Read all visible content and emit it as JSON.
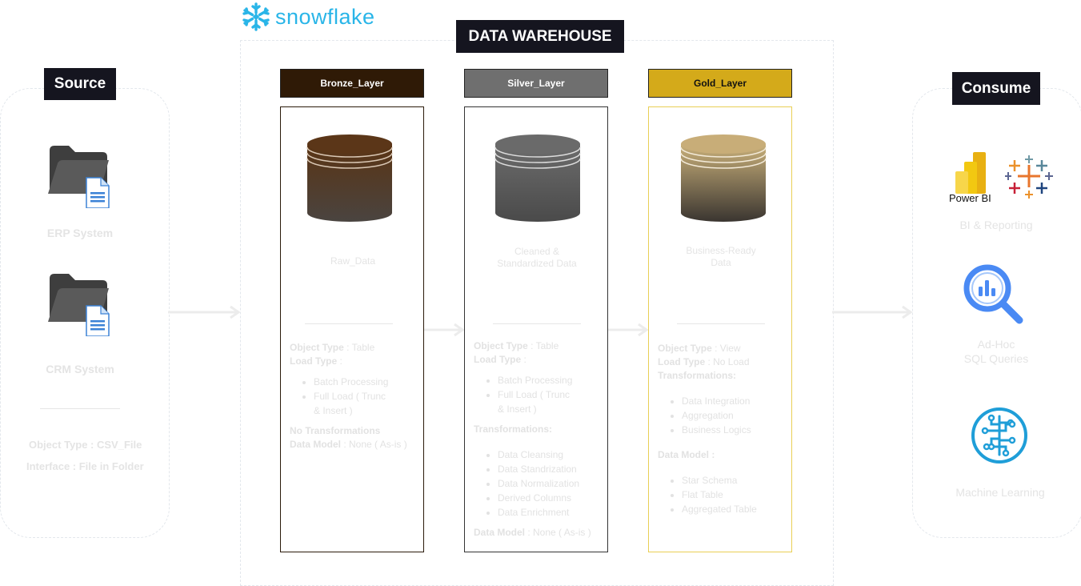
{
  "brand": {
    "name": "snowflake",
    "logo_icon": "snowflake-icon",
    "color": "#29b5e8"
  },
  "sections": {
    "source_title": "Source",
    "warehouse_title": "DATA WAREHOUSE",
    "consume_title": "Consume"
  },
  "source": {
    "systems": [
      {
        "label": "ERP System",
        "icon": "folder-document-icon"
      },
      {
        "label": "CRM System",
        "icon": "folder-document-icon"
      }
    ],
    "object_type": "Object Type : CSV_File",
    "interface": "Interface : File in Folder"
  },
  "layers": {
    "bronze": {
      "title": "Bronze_Layer",
      "color": "#2f1a06",
      "description": "Raw_Data",
      "object_type_label": "Object Type",
      "object_type_value": " : Table",
      "load_type_label": "Load Type",
      "load_type_value": " :",
      "load_items": [
        "Batch Processing",
        "Full Load ( Trunc",
        "& Insert )"
      ],
      "transformations": "No Transformations",
      "data_model_label": "Data Model",
      "data_model_value": " : None ( As-is )"
    },
    "silver": {
      "title": "Silver_Layer",
      "color": "#6f6f6f",
      "description_line1": "Cleaned &",
      "description_line2": "Standardized Data",
      "object_type_label": "Object Type",
      "object_type_value": " : Table",
      "load_type_label": "Load Type",
      "load_type_value": " :",
      "load_items": [
        "Batch Processing",
        "Full Load ( Trunc",
        "& Insert )"
      ],
      "transformations_title": "Transformations:",
      "transformation_items": [
        "Data Cleansing",
        "Data Standrization",
        "Data Normalization",
        "Derived Columns",
        "Data Enrichment"
      ],
      "data_model_label": "Data Model",
      "data_model_value": " : None ( As-is )"
    },
    "gold": {
      "title": "Gold_Layer",
      "color": "#d4aa1a",
      "description_line1": "Business-Ready",
      "description_line2": "Data",
      "object_type_label": "Object Type",
      "object_type_value": " : View",
      "load_type_label": "Load Type",
      "load_type_value": " : No Load",
      "transformations_title": "Transformations:",
      "transformation_items": [
        "Data Integration",
        "Aggregation",
        "Business Logics"
      ],
      "data_model_title": "Data Model :",
      "data_model_items": [
        "Star Schema",
        "Flat Table",
        "Aggregated Table"
      ]
    }
  },
  "consume": {
    "powerbi_label": "Power BI",
    "items": [
      {
        "label": "BI & Reporting",
        "icon": "powerbi-tableau-icon"
      },
      {
        "label_line1": "Ad-Hoc",
        "label_line2": "SQL Queries",
        "icon": "bigquery-icon"
      },
      {
        "label": "Machine Learning",
        "icon": "machine-learning-icon"
      }
    ]
  }
}
